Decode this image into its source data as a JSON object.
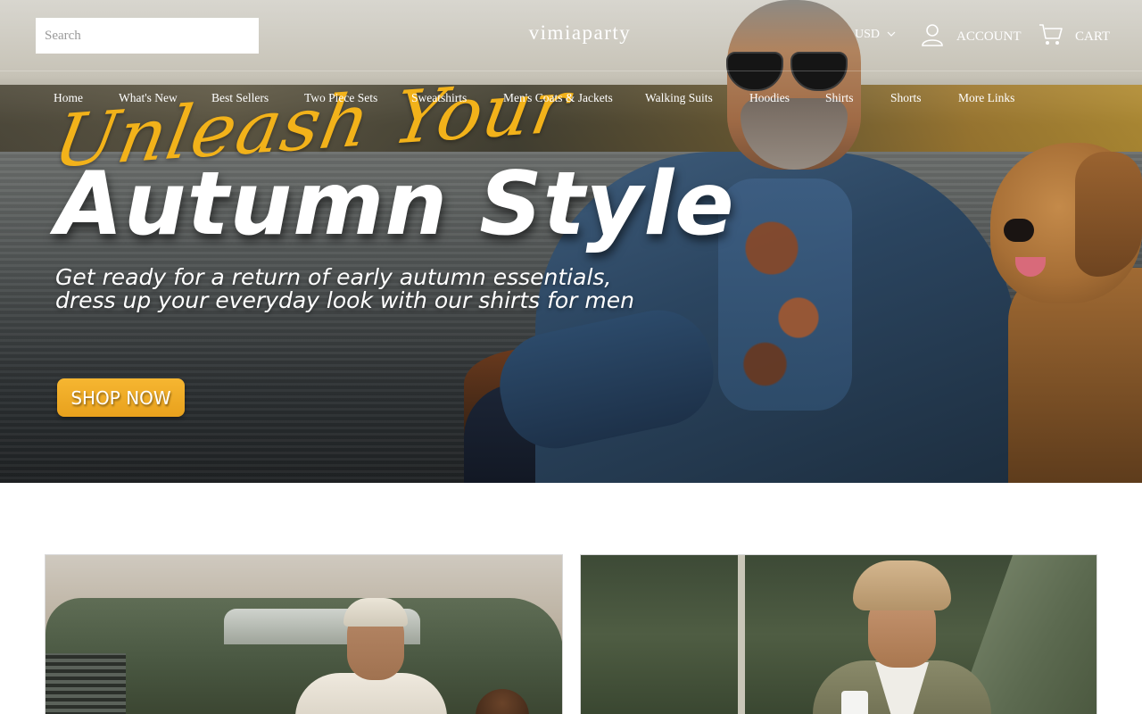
{
  "header": {
    "search_placeholder": "Search",
    "logo": "vimiaparty",
    "currency": "USD",
    "account_label": "ACCOUNT",
    "cart_label": "CART"
  },
  "nav": {
    "items": [
      {
        "label": "Home"
      },
      {
        "label": "What's New"
      },
      {
        "label": "Best Sellers"
      },
      {
        "label": "Two Piece Sets"
      },
      {
        "label": "Sweatshirts"
      },
      {
        "label": "Men's Coats & Jackets"
      },
      {
        "label": "Walking Suits"
      },
      {
        "label": "Hoodies"
      },
      {
        "label": "Shirts"
      },
      {
        "label": "Shorts"
      },
      {
        "label": "More Links"
      }
    ]
  },
  "hero": {
    "script_title": "Unleash Your",
    "headline": "Autumn Style",
    "subtitle_line1": "Get ready for a return of early autumn essentials,",
    "subtitle_line2": "dress up your everyday look with our shirts for men",
    "cta_label": "SHOP NOW"
  },
  "colors": {
    "accent": "#f2b21a",
    "cta_background": "#f1ad27",
    "header_text": "#ffffff",
    "page_background": "#ffffff"
  },
  "icons": {
    "account": "user-icon",
    "cart": "cart-icon",
    "currency_dropdown": "chevron-down-icon"
  }
}
